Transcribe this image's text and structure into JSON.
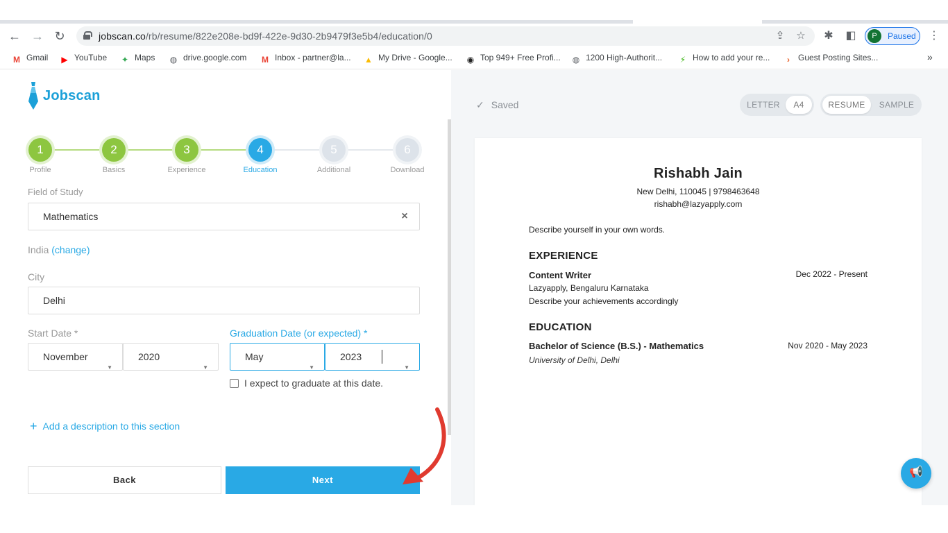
{
  "browser": {
    "url_domain": "jobscan.co",
    "url_path": "/rb/resume/822e208e-bd9f-422e-9d30-2b9479f3e5b4/education/0",
    "profile_initial": "P",
    "profile_status": "Paused",
    "bookmarks": [
      {
        "label": "Gmail",
        "icon": "gmail-icon",
        "glyph": "M",
        "color": "#ea4335"
      },
      {
        "label": "YouTube",
        "icon": "youtube-icon",
        "glyph": "▶",
        "color": "#ff0000"
      },
      {
        "label": "Maps",
        "icon": "maps-icon",
        "glyph": "✦",
        "color": "#34a853"
      },
      {
        "label": "drive.google.com",
        "icon": "globe-icon",
        "glyph": "◍",
        "color": "#5f6368"
      },
      {
        "label": "Inbox - partner@la...",
        "icon": "gmail-icon",
        "glyph": "M",
        "color": "#ea4335"
      },
      {
        "label": "My Drive - Google...",
        "icon": "drive-icon",
        "glyph": "▲",
        "color": "#fbbc04"
      },
      {
        "label": "Top 949+ Free Profi...",
        "icon": "feed-icon",
        "glyph": "◉",
        "color": "#222"
      },
      {
        "label": "1200 High-Authorit...",
        "icon": "globe-icon",
        "glyph": "◍",
        "color": "#5f6368"
      },
      {
        "label": "How to add your re...",
        "icon": "bolt-icon",
        "glyph": "⚡",
        "color": "#3fb618"
      },
      {
        "label": "Guest Posting Sites...",
        "icon": "arrow-icon",
        "glyph": "›",
        "color": "#e8632b"
      }
    ]
  },
  "app": {
    "brand": "Jobscan",
    "steps": [
      {
        "num": "1",
        "label": "Profile",
        "state": "done"
      },
      {
        "num": "2",
        "label": "Basics",
        "state": "done"
      },
      {
        "num": "3",
        "label": "Experience",
        "state": "done"
      },
      {
        "num": "4",
        "label": "Education",
        "state": "active"
      },
      {
        "num": "5",
        "label": "Additional",
        "state": "todo"
      },
      {
        "num": "6",
        "label": "Download",
        "state": "todo"
      }
    ],
    "field_of_study_label": "Field of Study",
    "field_of_study_value": "Mathematics",
    "country": "India",
    "country_change": "(change)",
    "city_label": "City",
    "city_value": "Delhi",
    "start_date_label": "Start Date *",
    "start_month": "November",
    "start_year": "2020",
    "grad_date_label": "Graduation Date (or expected) *",
    "grad_month": "May",
    "grad_year": "2023",
    "expect_checkbox_label": "I expect to graduate at this date.",
    "add_description": "Add a description to this section",
    "back_label": "Back",
    "next_label": "Next"
  },
  "preview": {
    "saved": "Saved",
    "paper_sizes": [
      "LETTER",
      "A4"
    ],
    "view_modes": [
      "RESUME",
      "SAMPLE"
    ],
    "name": "Rishabh Jain",
    "contact_line1": "New Delhi, 110045 | 9798463648",
    "contact_line2": "rishabh@lazyapply.com",
    "summary": "Describe yourself in your own words.",
    "experience_heading": "EXPERIENCE",
    "job_title": "Content Writer",
    "job_dates": "Dec 2022 - Present",
    "job_company": "Lazyapply, Bengaluru Karnataka",
    "job_desc": "Describe your achievements accordingly",
    "education_heading": "EDUCATION",
    "degree": "Bachelor of Science (B.S.) - Mathematics",
    "degree_dates": "Nov 2020 - May 2023",
    "school": "University of Delhi, Delhi"
  },
  "colors": {
    "accent": "#29a9e5",
    "done_green": "#8dc640",
    "arrow_red": "#e03a2f"
  }
}
